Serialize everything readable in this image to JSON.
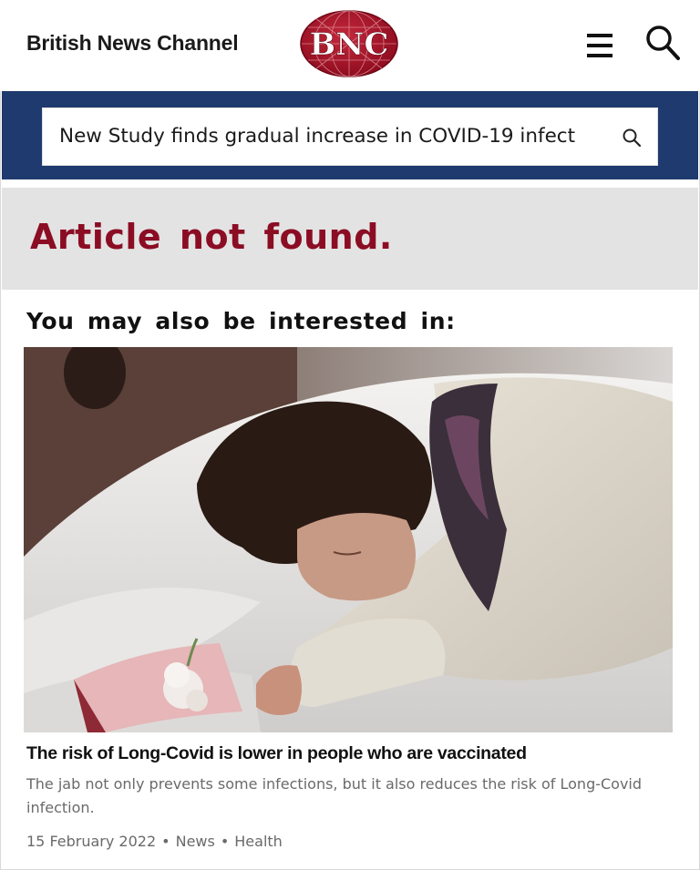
{
  "header": {
    "site_name": "British News Channel",
    "logo_text": "BNC",
    "menu_icon": "hamburger-menu-icon",
    "search_icon": "search-icon"
  },
  "search": {
    "value": "New Study finds gradual increase in COVID-19 infect",
    "icon": "search-icon"
  },
  "notice": {
    "title": "Article not found."
  },
  "related": {
    "heading": "You may also be interested in:",
    "article": {
      "image_alt": "Woman in a knitted sweater sleeping on white bed sheets beside a book and flower",
      "title": "The risk of Long-Covid is lower in people who are vaccinated",
      "summary": "The jab not only prevents some infections, but it also reduces the risk of Long-Covid infection.",
      "date": "15 February 2022",
      "section": "News",
      "category": "Health",
      "separator": "•"
    }
  },
  "colors": {
    "brand_red": "#8b0d24",
    "band_blue": "#1e3a6e",
    "band_grey": "#e3e3e3",
    "muted_text": "#6a6a6a"
  }
}
